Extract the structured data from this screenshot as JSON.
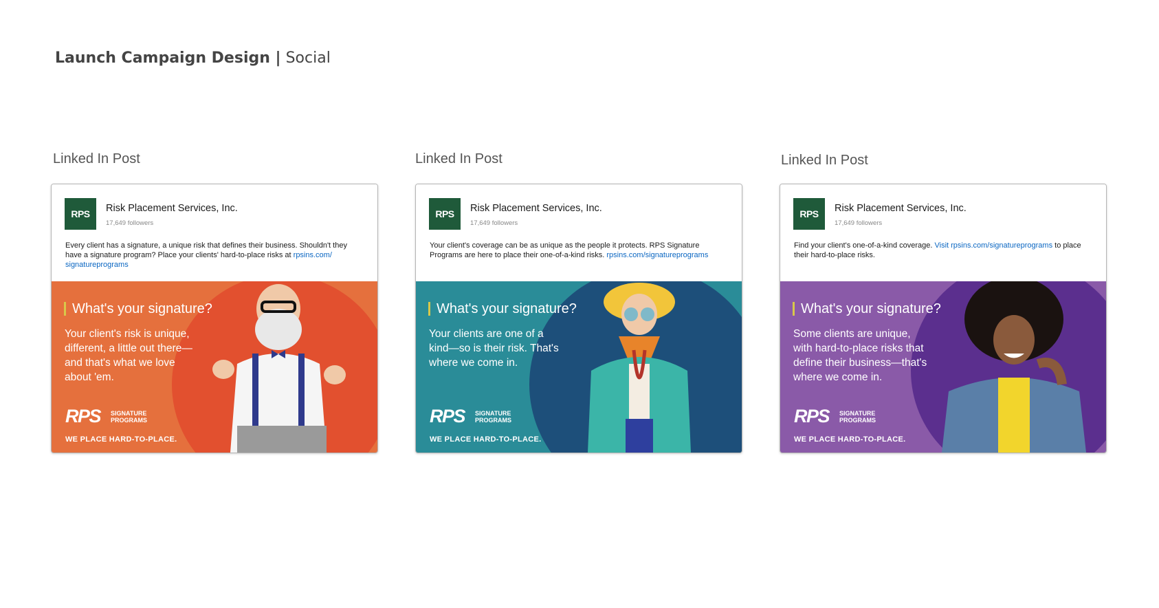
{
  "page": {
    "title_bold": "Launch Campaign Design |",
    "title_sub": "Social"
  },
  "posts": [
    {
      "label": "Linked In Post",
      "logo_text": "RPS",
      "company_name": "Risk Placement Services, Inc.",
      "followers": "17,649 followers",
      "text": "Every client has a signature, a unique risk that defines their business. Shouldn't they have a signature program? Place your clients' hard-to-place risks at ",
      "link": "rpsins.com/ signatureprograms",
      "text_after": "",
      "headline": "What's your signature?",
      "body": "Your client's risk is unique, different, a little out there—and that's what we love about 'em.",
      "logo_mark": "RPS",
      "logo_sub": "SIGNATURE PROGRAMS",
      "tagline": "WE PLACE HARD-TO-PLACE.",
      "colors": {
        "bg": "#e5703d",
        "circle": "#e2502f"
      }
    },
    {
      "label": "Linked In Post",
      "logo_text": "RPS",
      "company_name": "Risk Placement Services, Inc.",
      "followers": "17,649 followers",
      "text": "Your client's coverage can be as unique as the people it protects. RPS Signature Programs are here to place their one-of-a-kind risks. ",
      "link": "rpsins.com/signatureprograms",
      "text_after": "",
      "headline": "What's your signature?",
      "body": "Your clients are one of a kind—so is their risk. That's where we come in.",
      "logo_mark": "RPS",
      "logo_sub": "SIGNATURE PROGRAMS",
      "tagline": "WE PLACE HARD-TO-PLACE.",
      "colors": {
        "bg": "#2a8c98",
        "circle": "#1d4f7a"
      }
    },
    {
      "label": "Linked In Post",
      "logo_text": "RPS",
      "company_name": "Risk Placement Services, Inc.",
      "followers": "17,649 followers",
      "text": "Find your client's one-of-a-kind coverage. ",
      "link": "Visit rpsins.com/signatureprograms",
      "text_after": " to place their hard-to-place risks.",
      "headline": "What's your signature?",
      "body": "Some clients are unique, with hard-to-place risks that define their business—that's where we come in.",
      "logo_mark": "RPS",
      "logo_sub": "SIGNATURE PROGRAMS",
      "tagline": "WE PLACE HARD-TO-PLACE.",
      "colors": {
        "bg": "#8a5aa8",
        "circle": "#5b2f8e"
      }
    }
  ]
}
